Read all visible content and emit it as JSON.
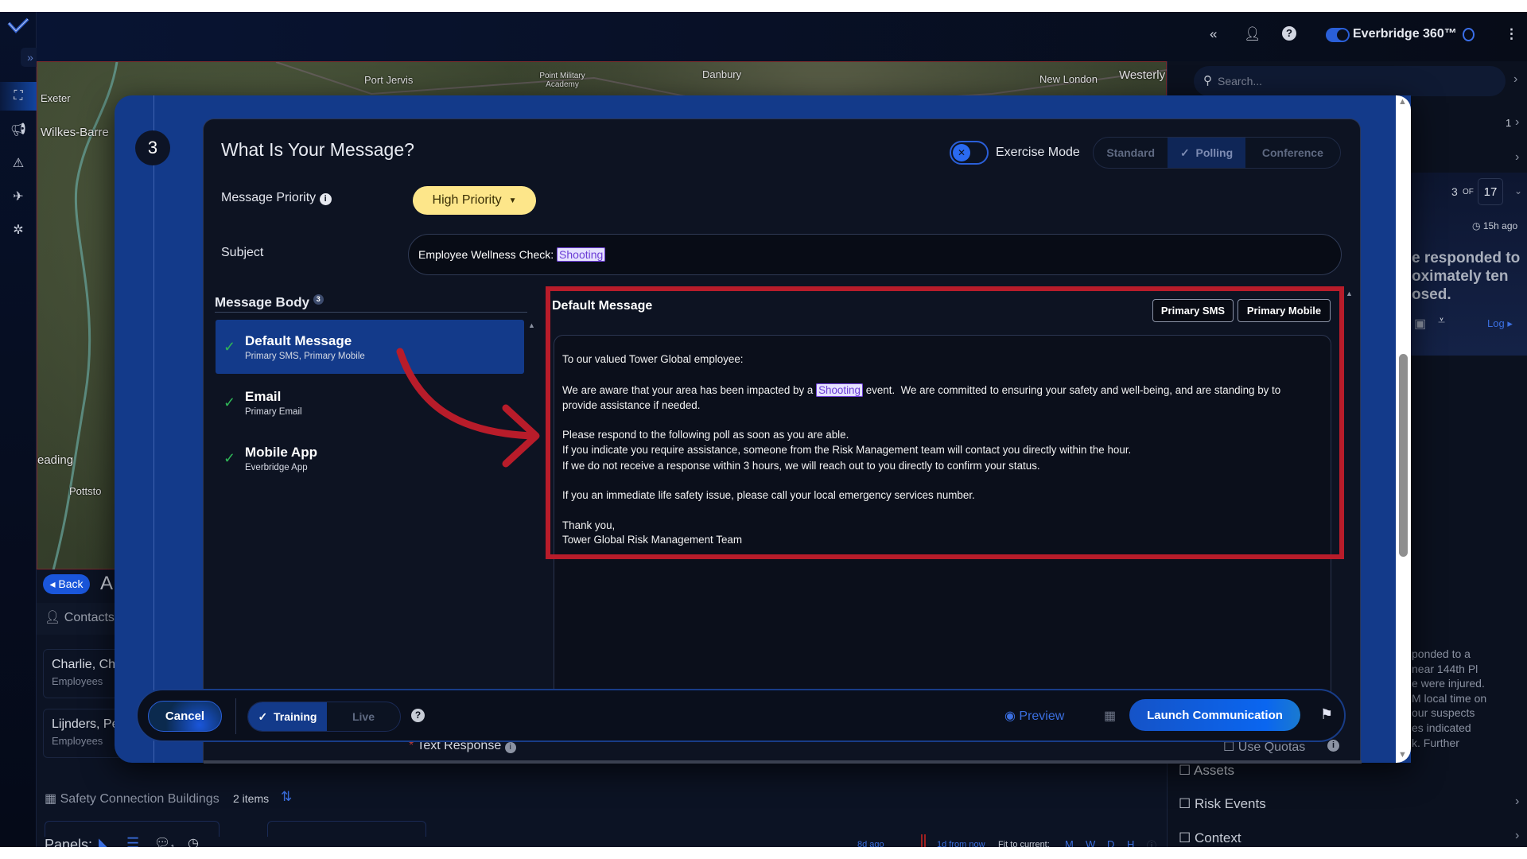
{
  "header": {
    "brand": "Everbridge 360™",
    "search_placeholder": "Search..."
  },
  "icons": {
    "logo": "everbridge-logo",
    "collapse": "double-chevron-left",
    "user": "user-icon",
    "help": "question-icon",
    "chat": "chat-icon",
    "more": "kebab-icon"
  },
  "sidebar": {
    "items": [
      "map",
      "megaphone",
      "incident",
      "airplane",
      "network"
    ]
  },
  "map": {
    "labels": [
      "Port Jervis",
      "Danbury",
      "New London",
      "Westerly",
      "Exeter",
      "Wilkes-Barre",
      "eading",
      "Pottsto",
      "Point Military Academy"
    ]
  },
  "left_panel": {
    "back": "Back",
    "title_partial": "A",
    "contacts": "Contacts",
    "cards": [
      {
        "name": "Charlie, Ch",
        "group": "Employees"
      },
      {
        "name": "Lijnders, Pe",
        "group": "Employees"
      }
    ],
    "buildings": "Safety Connection Buildings",
    "buildings_count": "2 items",
    "panels_label": "Panels:",
    "panel_badge": "1"
  },
  "timeline": {
    "left": "8d ago",
    "right": "1d from now",
    "fit": "Fit to current:",
    "scales": [
      "M",
      "W",
      "D",
      "H"
    ]
  },
  "right_panel": {
    "count1": "1",
    "page_current": "3",
    "page_of": "OF",
    "page_total": "17",
    "age": "15h ago",
    "summary": [
      "e responded to",
      "oximately ten",
      "osed."
    ],
    "log": "Log",
    "story": [
      "ponded to a",
      "near 144th Pl",
      "e were injured.",
      "M local time on",
      "our suspects",
      "es indicated",
      "k. Further"
    ],
    "sections": [
      "Assets",
      "Risk Events",
      "Context"
    ]
  },
  "modal": {
    "step": "3",
    "title": "What Is Your Message?",
    "exercise_mode": "Exercise Mode",
    "exercise_on": false,
    "modes": [
      "Standard",
      "Polling",
      "Conference"
    ],
    "selected_mode": "Polling",
    "priority_label": "Message Priority",
    "priority_value": "High Priority",
    "subject_label": "Subject",
    "subject_prefix": "Employee Wellness Check: ",
    "subject_token": "Shooting",
    "body_label": "Message Body",
    "body_count": "3",
    "bodies": [
      {
        "title": "Default Message",
        "sub": "Primary SMS, Primary Mobile",
        "selected": true
      },
      {
        "title": "Email",
        "sub": "Primary Email"
      },
      {
        "title": "Mobile App",
        "sub": "Everbridge App"
      }
    ],
    "editor_title": "Default Message",
    "channels": [
      "Primary SMS",
      "Primary Mobile"
    ],
    "message": {
      "greeting": "To our valued Tower Global employee:",
      "p1_a": "We are aware that your area has been impacted by a ",
      "p1_token": "Shooting",
      "p1_b": " event.  We are committed to ensuring your safety and well-being, and are standing by to",
      "p1_c": "provide assistance if needed.",
      "p2_a": "Please respond to the following poll as soon as you are able.",
      "p2_b": "If you indicate you require assistance, someone from the Risk Management team will contact you directly within the hour.",
      "p2_c": "If we do not receive a response within 3 hours, we will reach out to you directly to confirm your status.",
      "p3": "If you an immediate life safety issue, please call your local emergency services number.",
      "closing": "Thank you,",
      "signature": "Tower Global Risk Management Team"
    },
    "text_response": "Text Response",
    "use_quotas": "Use Quotas",
    "cancel": "Cancel",
    "training": "Training",
    "live": "Live",
    "preview": "Preview",
    "launch": "Launch Communication"
  },
  "colors": {
    "accent": "#1a56db",
    "highlight": "#b81c2a",
    "priority": "#fde68a",
    "modal": "#133a8a"
  }
}
